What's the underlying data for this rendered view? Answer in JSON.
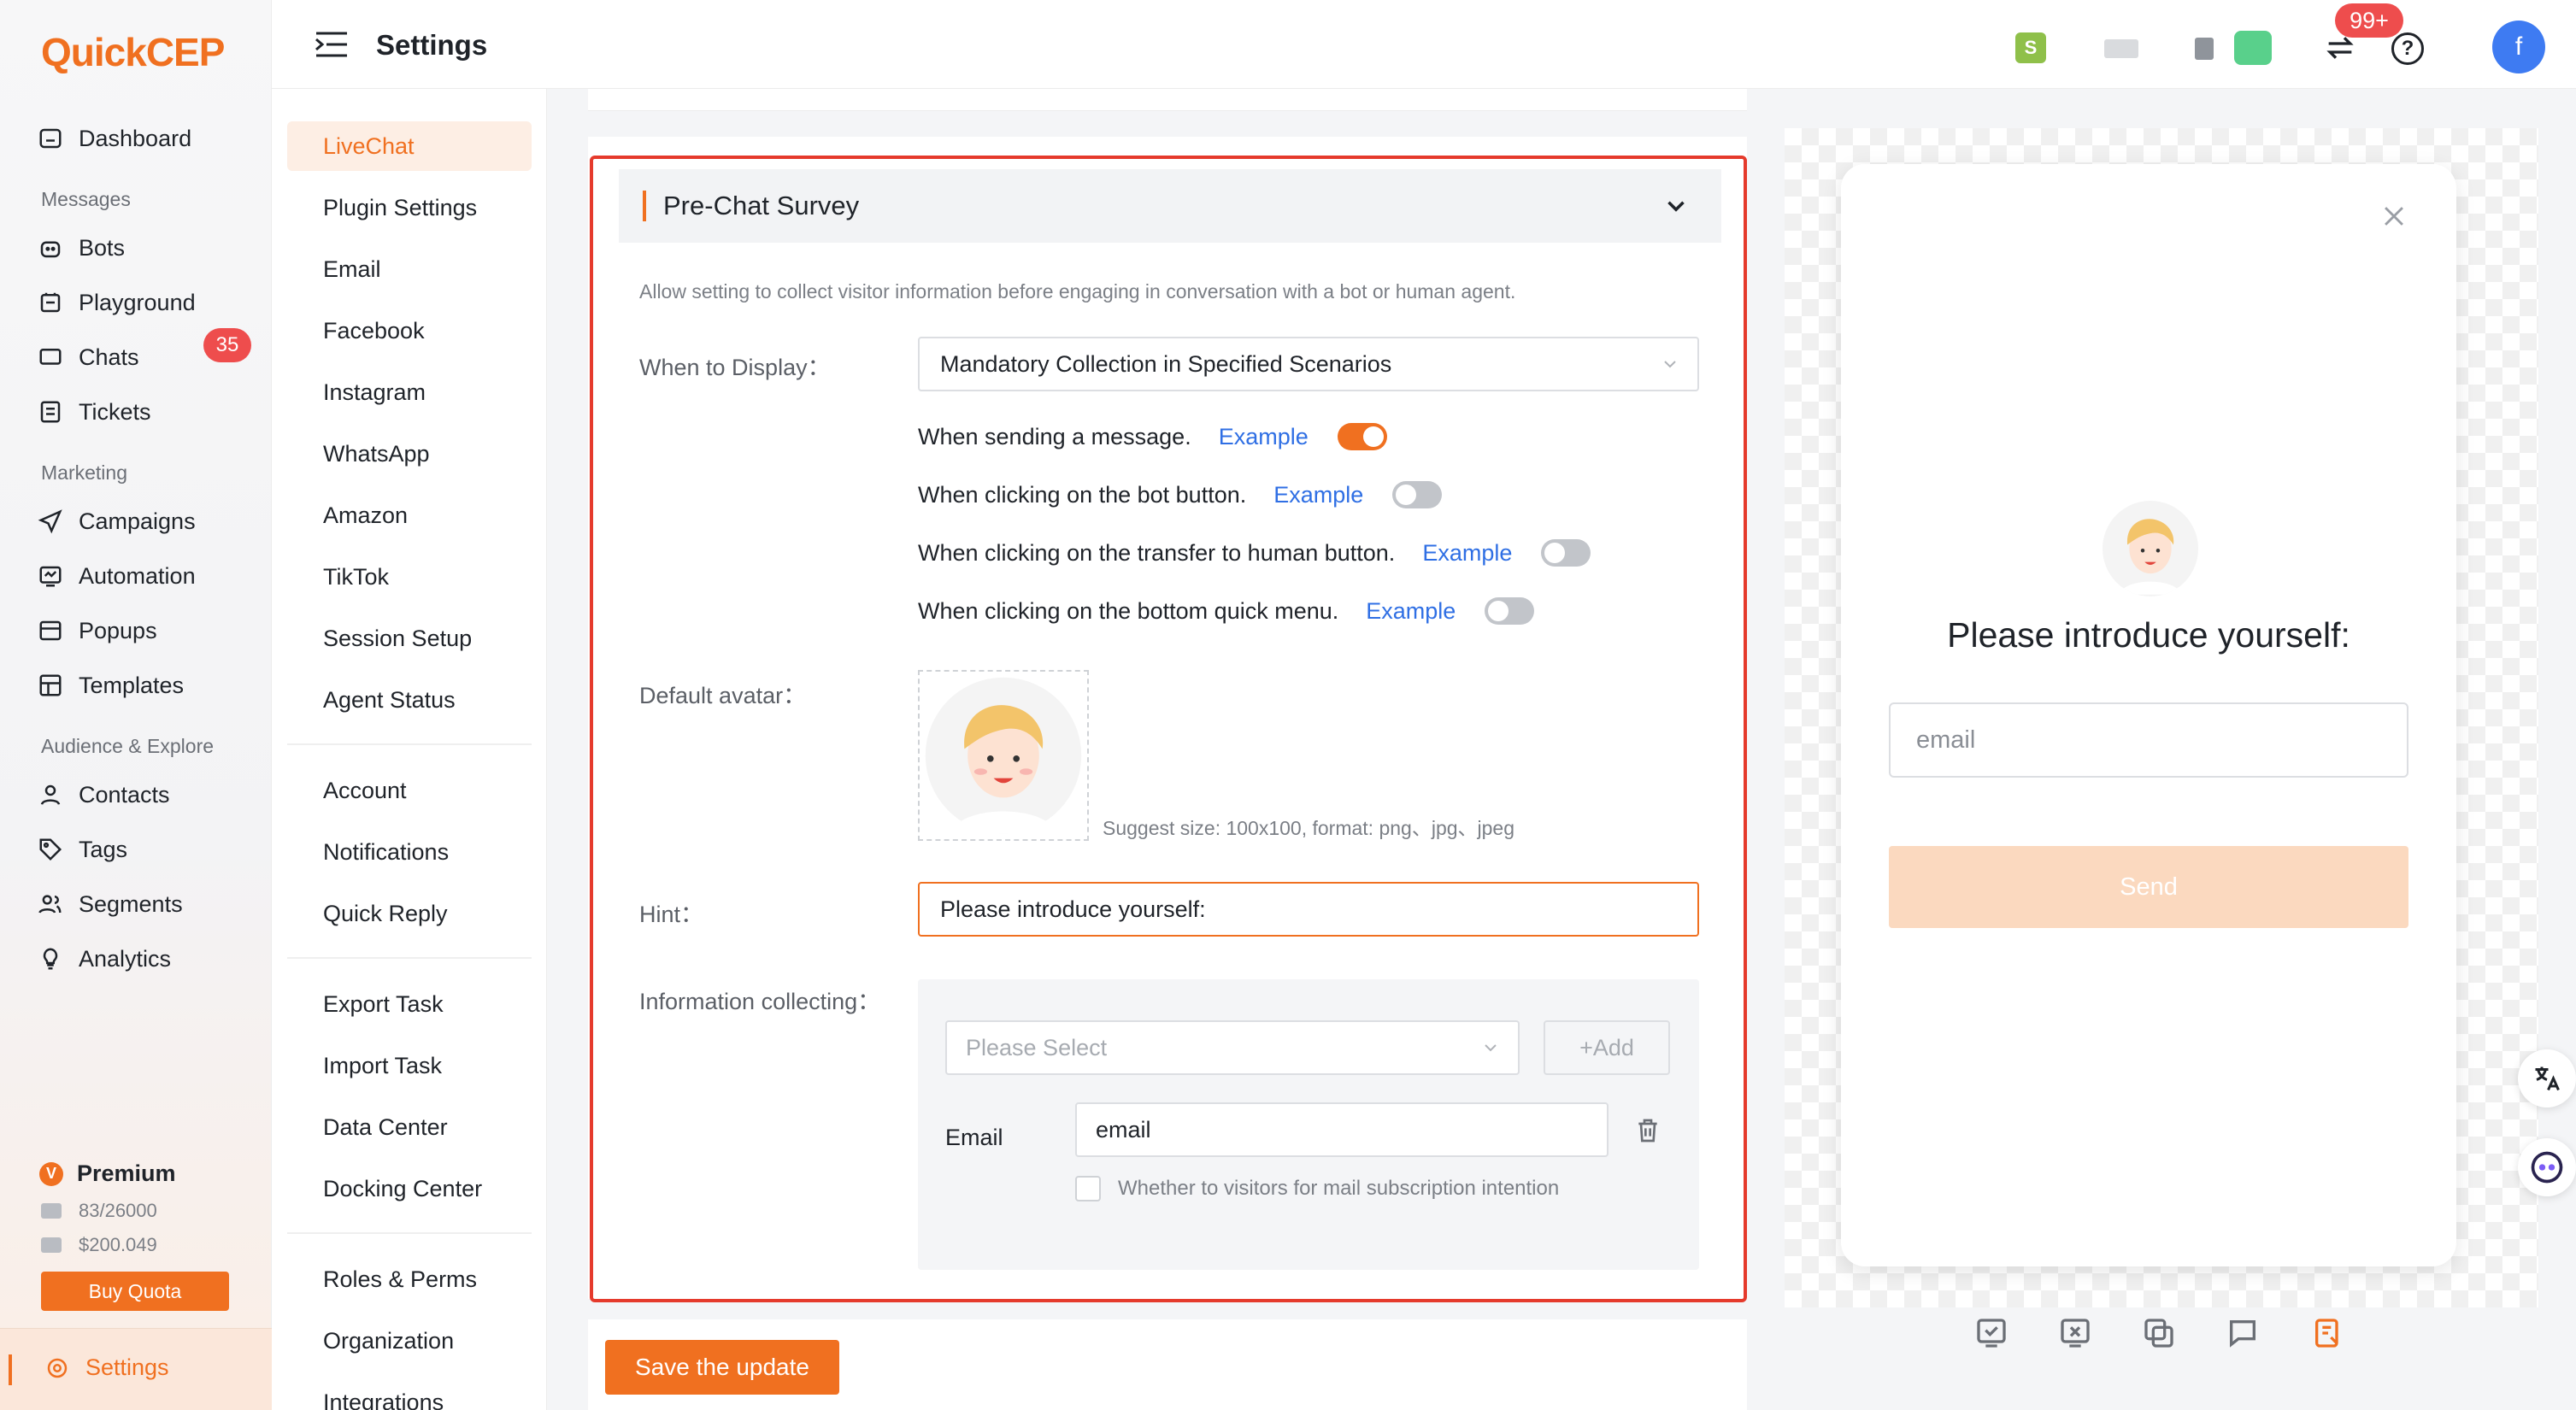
{
  "app": {
    "logo": "QuickCEP"
  },
  "header": {
    "title": "Settings",
    "notification_count": "99+",
    "avatar_initial": "f",
    "help_glyph": "?"
  },
  "nav": {
    "dashboard": "Dashboard",
    "group_messages": "Messages",
    "bots": "Bots",
    "playground": "Playground",
    "chats": "Chats",
    "chats_badge": "35",
    "tickets": "Tickets",
    "group_marketing": "Marketing",
    "campaigns": "Campaigns",
    "automation": "Automation",
    "popups": "Popups",
    "templates": "Templates",
    "group_audience": "Audience & Explore",
    "contacts": "Contacts",
    "tags": "Tags",
    "segments": "Segments",
    "analytics": "Analytics",
    "plan": "Premium",
    "plan_initial": "V",
    "quota_usage": "83/26000",
    "balance": "$200.049",
    "buy_quota": "Buy Quota",
    "settings": "Settings"
  },
  "subnav": {
    "items_a": [
      "LiveChat",
      "Plugin Settings",
      "Email",
      "Facebook",
      "Instagram",
      "WhatsApp",
      "Amazon",
      "TikTok",
      "Session Setup",
      "Agent Status"
    ],
    "items_b": [
      "Account",
      "Notifications",
      "Quick Reply"
    ],
    "items_c": [
      "Export Task",
      "Import Task",
      "Data Center",
      "Docking Center"
    ],
    "items_d": [
      "Roles & Perms",
      "Organization",
      "Integrations"
    ],
    "active": "LiveChat"
  },
  "survey": {
    "title": "Pre-Chat Survey",
    "description": "Allow setting to collect visitor information before engaging in conversation with a bot or human agent.",
    "when_label": "When to Display：",
    "when_value": "Mandatory Collection in Specified Scenarios",
    "scenarios": [
      {
        "text": "When sending a message.",
        "example": "Example",
        "enabled": true
      },
      {
        "text": "When clicking on the bot button.",
        "example": "Example",
        "enabled": false
      },
      {
        "text": "When clicking on the transfer to human button.",
        "example": "Example",
        "enabled": false
      },
      {
        "text": "When clicking on the bottom quick menu.",
        "example": "Example",
        "enabled": false
      }
    ],
    "avatar_label": "Default avatar：",
    "avatar_suggest": "Suggest size: 100x100, format: png、jpg、jpeg",
    "hint_label": "Hint：",
    "hint_value": "Please introduce yourself:",
    "info_label": "Information collecting：",
    "info_select_placeholder": "Please Select",
    "add_label": "+Add",
    "email_field_label": "Email",
    "email_field_value": "email",
    "subscription_checkbox": "Whether to visitors for mail subscription intention",
    "save_label": "Save the update"
  },
  "preview": {
    "title": "Please introduce yourself:",
    "input_placeholder": "email",
    "send_label": "Send"
  },
  "colors": {
    "accent": "#f07020",
    "danger": "#e53a2c",
    "link": "#2f6fe4"
  }
}
